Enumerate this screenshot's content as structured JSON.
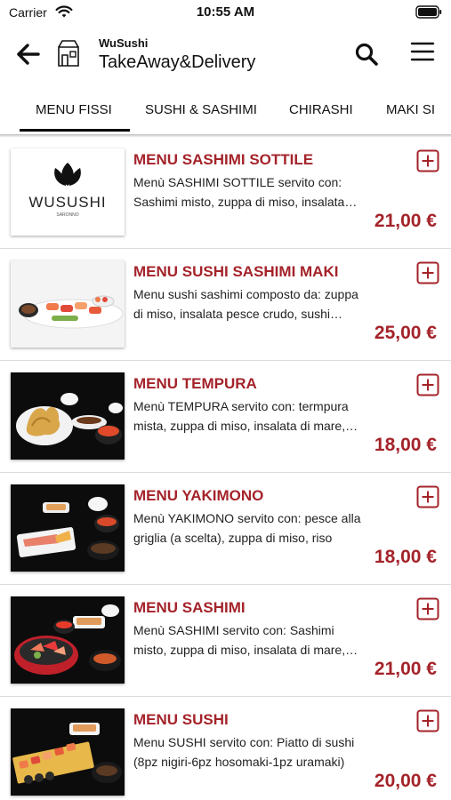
{
  "status_bar": {
    "carrier": "Carrier",
    "time": "10:55 AM"
  },
  "header": {
    "subtitle": "WuSushi",
    "title": "TakeAway&Delivery"
  },
  "tabs": [
    {
      "label": "MENU FISSI",
      "selected": true
    },
    {
      "label": "SUSHI & SASHIMI"
    },
    {
      "label": "CHIRASHI"
    },
    {
      "label": "MAKI SI"
    }
  ],
  "logo": {
    "brand": "WUSUSHI",
    "city": "SARONNO"
  },
  "colors": {
    "accent": "#a4232a",
    "text": "#111111",
    "divider": "#dcdcdc"
  },
  "items": [
    {
      "title": "MENU SASHIMI SOTTILE",
      "description": "Menù SASHIMI SOTTILE servito con: Sashimi misto, zuppa di miso, insalata mista",
      "price": "21,00 €",
      "image": "wusushi-logo"
    },
    {
      "title": "MENU SUSHI SASHIMI MAKI",
      "description": "Menu sushi sashimi composto da: zuppa di miso, insalata pesce crudo, sushi misto",
      "price": "25,00 €",
      "image": "sushi-sashimi-platter"
    },
    {
      "title": "MENU TEMPURA",
      "description": "Menù TEMPURA servito con: termpura mista, zuppa di miso, insalata di mare, riso",
      "price": "18,00 €",
      "image": "tempura-plate"
    },
    {
      "title": "MENU YAKIMONO",
      "description": "Menù YAKIMONO servito con: pesce alla griglia (a scelta), zuppa di miso, riso",
      "price": "18,00 €",
      "image": "grilled-fish-plate"
    },
    {
      "title": "MENU SASHIMI",
      "description": "Menù SASHIMI servito con: Sashimi misto, zuppa di miso, insalata di mare, riso",
      "price": "21,00 €",
      "image": "sashimi-bowl"
    },
    {
      "title": "MENU SUSHI",
      "description": "Menu SUSHI servito con: Piatto di sushi (8pz nigiri-6pz hosomaki-1pz uramaki)",
      "price": "20,00 €",
      "image": "sushi-board"
    }
  ]
}
